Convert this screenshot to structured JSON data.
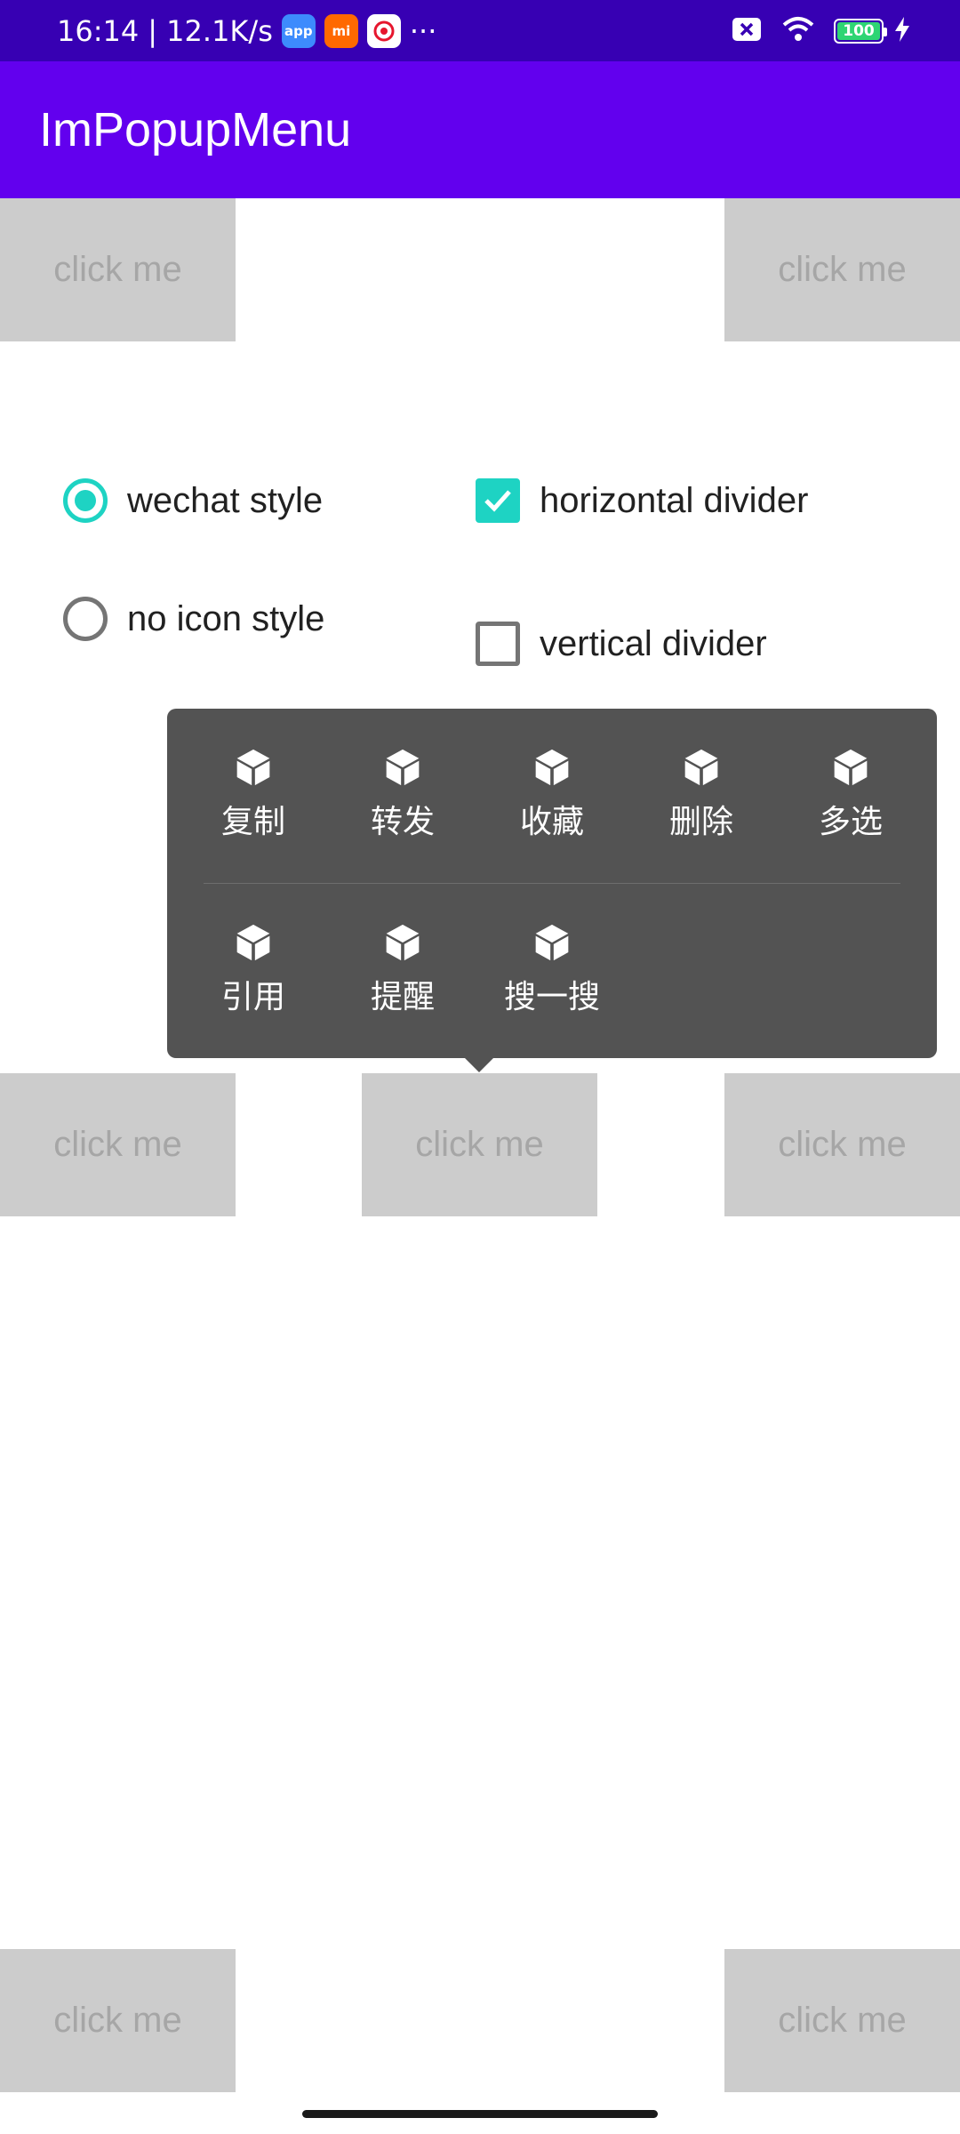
{
  "status_bar": {
    "time": "16:14",
    "network_speed": "| 12.1K/s",
    "app_icons": [
      {
        "name": "app-store-icon",
        "label": "app",
        "color": "#3d8bfd"
      },
      {
        "name": "mi-icon",
        "label": "mi",
        "color": "#ff6900"
      },
      {
        "name": "weibo-icon",
        "label": "",
        "color": "#ffffff"
      }
    ],
    "more": "···",
    "battery": "100",
    "icons": [
      "sim-disabled-icon",
      "wifi-icon",
      "battery-icon",
      "charging-icon"
    ]
  },
  "app_bar": {
    "title": "ImPopupMenu",
    "color": "#6200ee"
  },
  "buttons": {
    "top_left": "click me",
    "top_right": "click me",
    "middle_left": "click me",
    "middle_center": "click me",
    "middle_right": "click me",
    "bottom_left": "click me",
    "bottom_right": "click me"
  },
  "options": {
    "wechat_style": {
      "label": "wechat style",
      "selected": true
    },
    "no_icon_style": {
      "label": "no icon style",
      "selected": false
    },
    "horizontal_divider": {
      "label": "horizontal divider",
      "checked": true
    },
    "vertical_divider": {
      "label": "vertical divider",
      "checked": false
    },
    "accent_color": "#1ed3c3"
  },
  "popup_menu": {
    "row1": [
      {
        "label": "复制",
        "icon": "cube-icon"
      },
      {
        "label": "转发",
        "icon": "cube-icon"
      },
      {
        "label": "收藏",
        "icon": "cube-icon"
      },
      {
        "label": "删除",
        "icon": "cube-icon"
      },
      {
        "label": "多选",
        "icon": "cube-icon"
      }
    ],
    "row2": [
      {
        "label": "引用",
        "icon": "cube-icon"
      },
      {
        "label": "提醒",
        "icon": "cube-icon"
      },
      {
        "label": "搜一搜",
        "icon": "cube-icon"
      }
    ],
    "background": "#535353"
  }
}
